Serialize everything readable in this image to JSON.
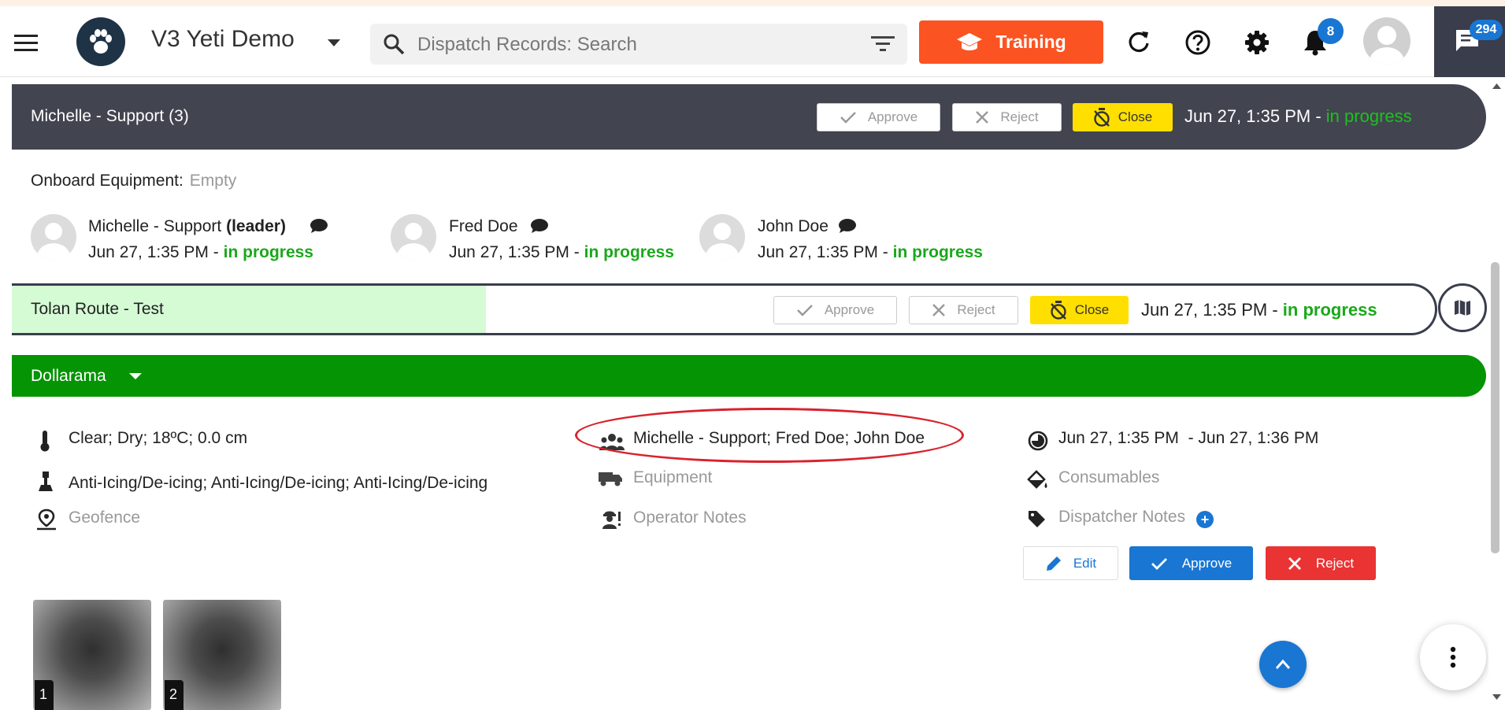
{
  "app": {
    "name": "V3 Yeti Demo"
  },
  "search": {
    "placeholder": "Dispatch Records: Search"
  },
  "toolbar": {
    "training_label": "Training",
    "notifications_count": "8",
    "messages_count": "294"
  },
  "record": {
    "title": "Michelle - Support (3)",
    "approve_label": "Approve",
    "reject_label": "Reject",
    "close_label": "Close",
    "date": "Jun 27, 1:35 PM",
    "separator": "-",
    "status": "in progress"
  },
  "onboard": {
    "label": "Onboard Equipment:",
    "value": "Empty"
  },
  "crew": [
    {
      "name": "Michelle - Support",
      "role": "(leader)",
      "date": "Jun 27, 1:35 PM",
      "separator": "-",
      "status": "in progress"
    },
    {
      "name": "Fred Doe",
      "role": "",
      "date": "Jun 27, 1:35 PM",
      "separator": "-",
      "status": "in progress"
    },
    {
      "name": "John Doe",
      "role": "",
      "date": "Jun 27, 1:35 PM",
      "separator": "-",
      "status": "in progress"
    }
  ],
  "route": {
    "title": "Tolan Route - Test",
    "approve_label": "Approve",
    "reject_label": "Reject",
    "close_label": "Close",
    "date": "Jun 27, 1:35 PM",
    "separator": "-",
    "status": "in progress"
  },
  "site": {
    "title": "Dollarama",
    "weather": "Clear; Dry; 18ºC; 0.0 cm",
    "services": "Anti-Icing/De-icing; Anti-Icing/De-icing; Anti-Icing/De-icing",
    "geofence": "Geofence",
    "crew": "Michelle - Support; Fred Doe; John Doe",
    "equipment": "Equipment",
    "operator_notes": "Operator Notes",
    "time_range": "Jun 27, 1:35 PM  - Jun 27, 1:36 PM",
    "consumables": "Consumables",
    "dispatcher_notes": "Dispatcher Notes",
    "edit_label": "Edit",
    "approve_label": "Approve",
    "reject_label": "Reject"
  },
  "photos": [
    {
      "number": "1"
    },
    {
      "number": "2"
    }
  ],
  "colors": {
    "accent": "#1976d2",
    "training": "#fb5321",
    "header_dark": "#424450",
    "site_green": "#049404",
    "close_yellow": "#ffdf00",
    "status_green": "#1aa81a",
    "reject_red": "#ea3333"
  }
}
